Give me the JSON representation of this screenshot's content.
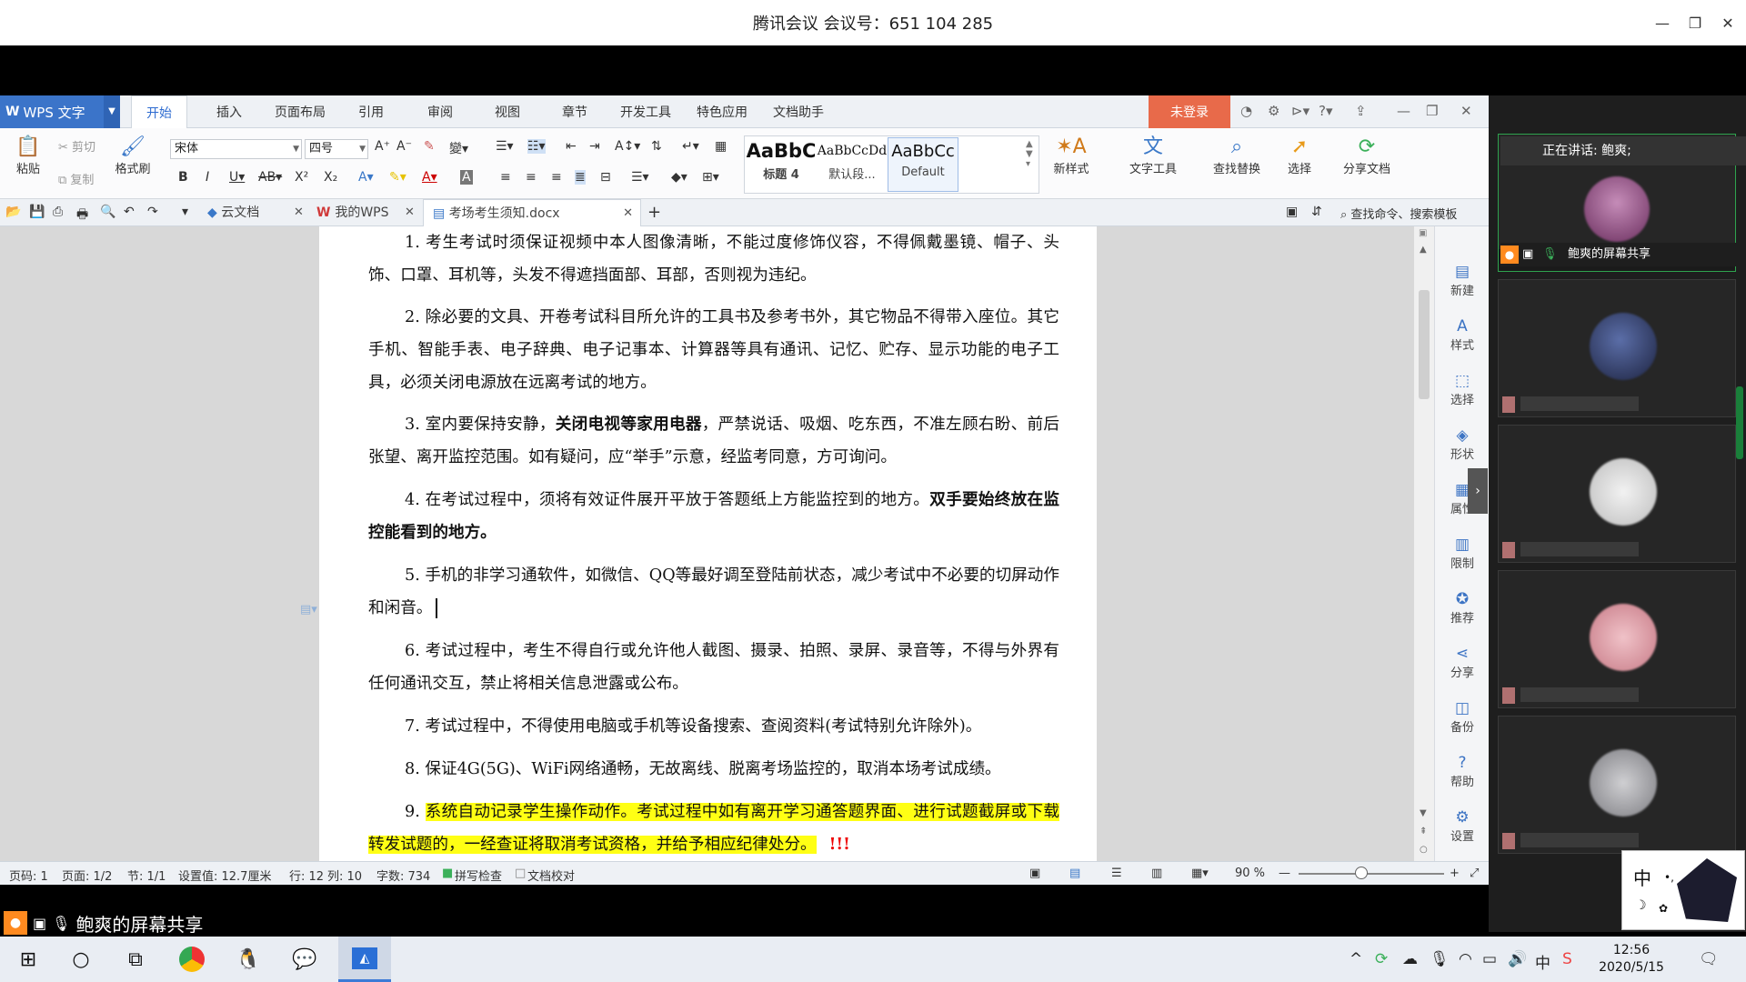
{
  "window": {
    "title": "腾讯会议  会议号：651 104 285"
  },
  "wps": {
    "app_name": "WPS 文字",
    "menu_tabs": [
      "开始",
      "插入",
      "页面布局",
      "引用",
      "审阅",
      "视图",
      "章节",
      "开发工具",
      "特色应用",
      "文档助手"
    ],
    "login_label": "未登录",
    "ribbon": {
      "paste": "粘贴",
      "cut": "剪切",
      "copy": "复制",
      "format_painter": "格式刷",
      "font_name": "宋体",
      "font_size": "四号",
      "styles": [
        {
          "preview": "AaBbC",
          "label": "标题 4"
        },
        {
          "preview": "AaBbCcDd",
          "label": "默认段..."
        },
        {
          "preview": "AaBbCc",
          "label": "Default"
        }
      ],
      "new_style": "新样式",
      "text_tools": "文字工具",
      "find_replace": "查找替换",
      "select": "选择",
      "share_doc": "分享文档"
    },
    "doc_tabs": [
      {
        "label": "云文档"
      },
      {
        "label": "我的WPS"
      },
      {
        "label": "考场考生须知.docx"
      }
    ],
    "search_cmd": "查找命令、搜索模板",
    "document": {
      "p1": "1. 考生考试时须保证视频中本人图像清晰，不能过度修饰仪容，不得佩戴墨镜、帽子、头饰、口罩、耳机等，头发不得遮挡面部、耳部，否则视为违纪。",
      "p2": "2. 除必要的文具、开卷考试科目所允许的工具书及参考书外，其它物品不得带入座位。其它手机、智能手表、电子辞典、电子记事本、计算器等具有通讯、记忆、贮存、显示功能的电子工具，必须关闭电源放在远离考试的地方。",
      "p3a": "3. 室内要保持安静，",
      "p3b": "关闭电视等家用电器",
      "p3c": "，严禁说话、吸烟、吃东西，不准左顾右盼、前后张望、离开监控范围。如有疑问，应“举手”示意，经监考同意，方可询问。",
      "p4a": "4. 在考试过程中，须将有效证件展开平放于答题纸上方能监控到的地方。",
      "p4b": "双手要始终放在监控能看到的地方。",
      "p5": "5. 手机的非学习通软件，如微信、QQ等最好调至登陆前状态，减少考试中不必要的切屏动作和闲音。",
      "p6": "6. 考试过程中，考生不得自行或允许他人截图、摄录、拍照、录屏、录音等，不得与外界有任何通讯交互，禁止将相关信息泄露或公布。",
      "p7": "7. 考试过程中，不得使用电脑或手机等设备搜索、查阅资料(考试特别允许除外)。",
      "p8": "8. 保证4G(5G)、WiFi网络通畅，无故离线、脱离考场监控的，取消本场考试成绩。",
      "p9num": "9. ",
      "p9": "系统自动记录学生操作动作。考试过程中如有离开学习通答题界面、进行试题截屏或下载转发试题的，一经查证将取消考试资格，并给予相应纪律处分。",
      "p9mark": "!!!"
    },
    "right_panel": [
      "新建",
      "样式",
      "选择",
      "形状",
      "属性",
      "限制",
      "推荐",
      "分享",
      "备份",
      "帮助",
      "设置"
    ],
    "status": {
      "page_num": "页码: 1",
      "page": "页面: 1/2",
      "section": "节: 1/1",
      "setting": "设置值: 12.7厘米",
      "row": "行: 12",
      "col": "列: 10",
      "words": "字数: 734",
      "spell": "拼写检查",
      "proof": "文档校对",
      "zoom": "90 %"
    }
  },
  "meeting": {
    "speaking": "正在讲话: 鲍爽;",
    "share_label": "鲍爽的屏幕共享",
    "share_label_bottom": "鲍爽的屏幕共享"
  },
  "ime": {
    "lang": "中"
  },
  "taskbar": {
    "time": "12:56",
    "date": "2020/5/15",
    "tray_lang": "中"
  }
}
